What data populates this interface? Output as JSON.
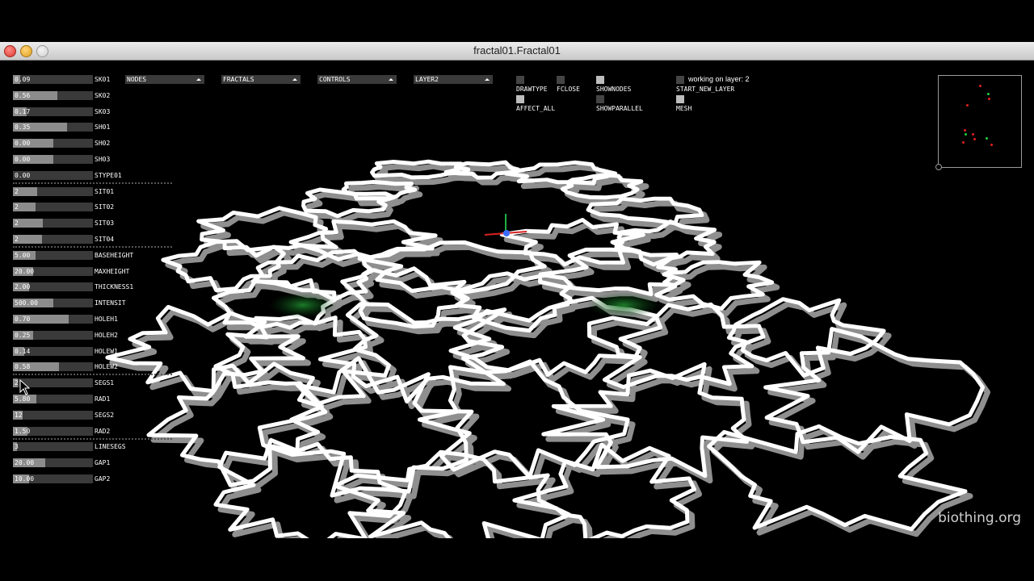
{
  "window": {
    "title": "fractal01.Fractal01"
  },
  "sliders": [
    {
      "value": "0.09",
      "label": "SK01",
      "fill": 0.09
    },
    {
      "value": "0.56",
      "label": "SK02",
      "fill": 0.56
    },
    {
      "value": "0.17",
      "label": "SK03",
      "fill": 0.17
    },
    {
      "value": "0.35",
      "label": "SH01",
      "fill": 0.68
    },
    {
      "value": "0.00",
      "label": "SH02",
      "fill": 0.5
    },
    {
      "value": "0.00",
      "label": "SH03",
      "fill": 0.5
    },
    {
      "value": "0.00",
      "label": "STYPE01",
      "fill": 0.0
    },
    {
      "value": "2",
      "label": "SIT01",
      "fill": 0.3
    },
    {
      "value": "2",
      "label": "SIT02",
      "fill": 0.28
    },
    {
      "value": "2",
      "label": "SIT03",
      "fill": 0.37
    },
    {
      "value": "2",
      "label": "SIT04",
      "fill": 0.36
    },
    {
      "value": "5.00",
      "label": "BASEHEIGHT",
      "fill": 0.28
    },
    {
      "value": "20.00",
      "label": "MAXHEIGHT",
      "fill": 0.25
    },
    {
      "value": "2.00",
      "label": "THICKNESS1",
      "fill": 0.2
    },
    {
      "value": "500.00",
      "label": "INTENSIT",
      "fill": 0.5
    },
    {
      "value": "0.70",
      "label": "HOLEH1",
      "fill": 0.7
    },
    {
      "value": "0.25",
      "label": "HOLEH2",
      "fill": 0.25
    },
    {
      "value": "0.14",
      "label": "HOLEW1",
      "fill": 0.14
    },
    {
      "value": "0.58",
      "label": "HOLEW2",
      "fill": 0.58
    },
    {
      "value": "2",
      "label": "SEGS1",
      "fill": 0.06
    },
    {
      "value": "5.80",
      "label": "RAD1",
      "fill": 0.29
    },
    {
      "value": "12",
      "label": "SEGS2",
      "fill": 0.12
    },
    {
      "value": "1.50",
      "label": "RAD2",
      "fill": 0.18
    },
    {
      "value": "3",
      "label": "LINESEGS",
      "fill": 0.05
    },
    {
      "value": "20.00",
      "label": "GAP1",
      "fill": 0.4
    },
    {
      "value": "10.00",
      "label": "GAP2",
      "fill": 0.2
    }
  ],
  "dropdowns": [
    {
      "label": "NODES"
    },
    {
      "label": "FRACTALS"
    },
    {
      "label": "CONTROLS"
    },
    {
      "label": "LAYER2"
    }
  ],
  "toggles": [
    {
      "label": "DRAWTYPE",
      "on": false
    },
    {
      "label": "FCLOSE",
      "on": false
    },
    {
      "label": "SHOWNODES",
      "on": true
    },
    {
      "label": "START_NEW_LAYER",
      "on": false
    },
    {
      "label": "AFFECT_ALL",
      "on": true
    },
    {
      "label": "SHOWPARALLEL",
      "on": false
    },
    {
      "label": "MESH",
      "on": true
    }
  ],
  "status": {
    "text": "working on layer: 2"
  },
  "minimap": {
    "points": [
      {
        "x": 0.49,
        "y": 0.1,
        "color": "#e02020"
      },
      {
        "x": 0.59,
        "y": 0.19,
        "color": "#20d040"
      },
      {
        "x": 0.6,
        "y": 0.24,
        "color": "#e02020"
      },
      {
        "x": 0.33,
        "y": 0.31,
        "color": "#e02020"
      },
      {
        "x": 0.3,
        "y": 0.58,
        "color": "#e02020"
      },
      {
        "x": 0.31,
        "y": 0.63,
        "color": "#20d040"
      },
      {
        "x": 0.4,
        "y": 0.63,
        "color": "#e02020"
      },
      {
        "x": 0.42,
        "y": 0.68,
        "color": "#e02020"
      },
      {
        "x": 0.28,
        "y": 0.72,
        "color": "#e02020"
      },
      {
        "x": 0.57,
        "y": 0.67,
        "color": "#20d040"
      },
      {
        "x": 0.63,
        "y": 0.74,
        "color": "#e02020"
      }
    ]
  },
  "watermark": "biothing.org",
  "colors": {
    "background": "#000000",
    "track": "#3a3a3a",
    "fill": "#8c8c8c",
    "wall": "#ffffff",
    "wallSide": "#9a9a9a"
  }
}
